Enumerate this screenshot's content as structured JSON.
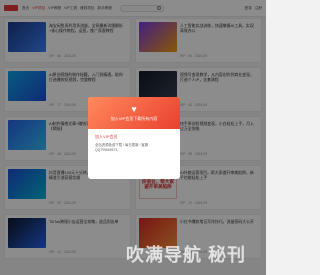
{
  "colors": {
    "accent": "#e23b3b",
    "modal_gradient": [
      "#ff8a5c",
      "#e9402f"
    ]
  },
  "header": {
    "nav": [
      "首页",
      "VIP项目",
      "VIP教程",
      "VIP工具",
      "赚钱项目",
      "新手教程"
    ],
    "active_index": 1,
    "user_links": [
      "登录",
      "注册"
    ]
  },
  "cards": [
    {
      "thumb": "",
      "title": "淘宝闲鱼再利用多流量，全网最新详细解析+核心操作教程，运营，推广获客教程",
      "meta": [
        "VIP",
        "86",
        "2024-09"
      ]
    },
    {
      "thumb": "",
      "title": "人工智能实战训练，快速掌握AI工具，实现高效办公",
      "meta": [
        "VIP",
        "54",
        "2024-09"
      ]
    },
    {
      "thumb": "",
      "title": "AI原创视频的制作秘籍，入门到精通，助你打造爆款短视频，完整教程",
      "meta": [
        "VIP",
        "77",
        "2024-09"
      ]
    },
    {
      "thumb": "",
      "title": "视频号变现教学，从内容创作到商业变现，打造个人IP，全套课程",
      "meta": [
        "VIP",
        "63",
        "2024-09"
      ]
    },
    {
      "thumb": "",
      "title": "AI制作情感文章+赚钱项目，单日收益500+【揭秘】",
      "meta": [
        "VIP",
        "45",
        "2024-09"
      ]
    },
    {
      "thumb": "",
      "title": "快手原创短视频变现，小白轻松上手，月入过万全攻略",
      "meta": [
        "VIP",
        "38",
        "2024-09"
      ]
    },
    {
      "thumb": "",
      "title": "抖音直播100元十分钟，抖音直播线上运营，精准引流获客实操",
      "meta": [
        "VIP",
        "92",
        "2024-09"
      ]
    },
    {
      "thumb": "民宿业，帮大家避开审美陷阱",
      "title": "AI外貌运营项目，帮大家避开审美陷阱，新手也能轻松上手",
      "meta": [
        "VIP",
        "29",
        "2024-09"
      ]
    },
    {
      "thumb": "",
      "title": "TikTok跨境小店运营全攻略，选品到出单",
      "meta": [
        "VIP",
        "41",
        "2024-09"
      ]
    },
    {
      "thumb": "",
      "title": "小红书爆款笔记写作技巧，流量密码大公开",
      "meta": [
        "VIP",
        "33",
        "2024-09"
      ]
    }
  ],
  "modal": {
    "title": "加入VIP会员下载所有内容",
    "subtitle": "加入VIP会员",
    "lines": [
      "全站资源免费下载 / 每日更新 / 客服",
      "QQ799669573"
    ]
  },
  "watermark": "吹满导航 秘刊"
}
